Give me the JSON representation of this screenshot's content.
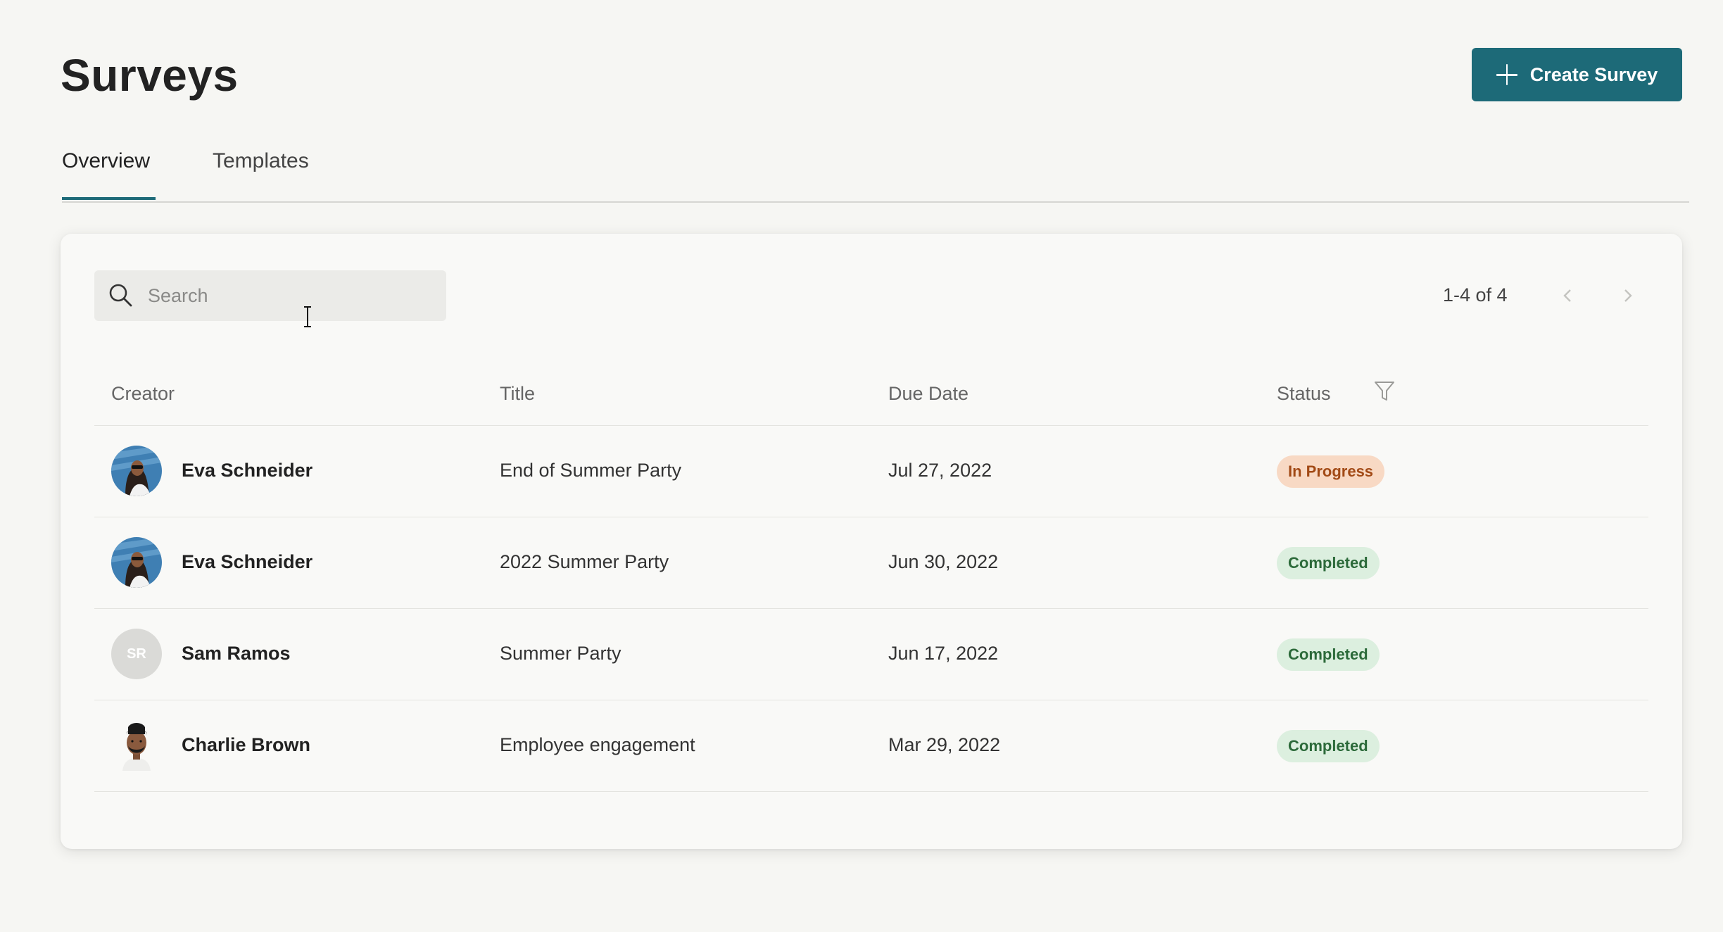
{
  "header": {
    "title": "Surveys",
    "create_button_label": "Create Survey"
  },
  "tabs": [
    {
      "label": "Overview",
      "active": true
    },
    {
      "label": "Templates",
      "active": false
    }
  ],
  "search": {
    "placeholder": "Search",
    "value": ""
  },
  "pagination": {
    "text": "1-4 of 4"
  },
  "table": {
    "columns": [
      "Creator",
      "Title",
      "Due Date",
      "Status"
    ],
    "rows": [
      {
        "creator": "Eva Schneider",
        "avatar": "photo-eva",
        "title": "End of Summer Party",
        "due_date": "Jul 27, 2022",
        "status": "In Progress"
      },
      {
        "creator": "Eva Schneider",
        "avatar": "photo-eva",
        "title": "2022 Summer Party",
        "due_date": "Jun 30, 2022",
        "status": "Completed"
      },
      {
        "creator": "Sam Ramos",
        "avatar": "initials",
        "initials": "SR",
        "title": "Summer Party",
        "due_date": "Jun 17, 2022",
        "status": "Completed"
      },
      {
        "creator": "Charlie Brown",
        "avatar": "illustration-charlie",
        "title": "Employee engagement",
        "due_date": "Mar 29, 2022",
        "status": "Completed"
      }
    ]
  },
  "colors": {
    "accent": "#1d6a78",
    "in_progress_bg": "#f8d9c4",
    "in_progress_text": "#a24a16",
    "completed_bg": "#dcefdf",
    "completed_text": "#2c6a3a"
  },
  "icons": {
    "create": "plus-icon",
    "search": "search-icon",
    "filter": "filter-icon",
    "prev": "chevron-left-icon",
    "next": "chevron-right-icon"
  }
}
